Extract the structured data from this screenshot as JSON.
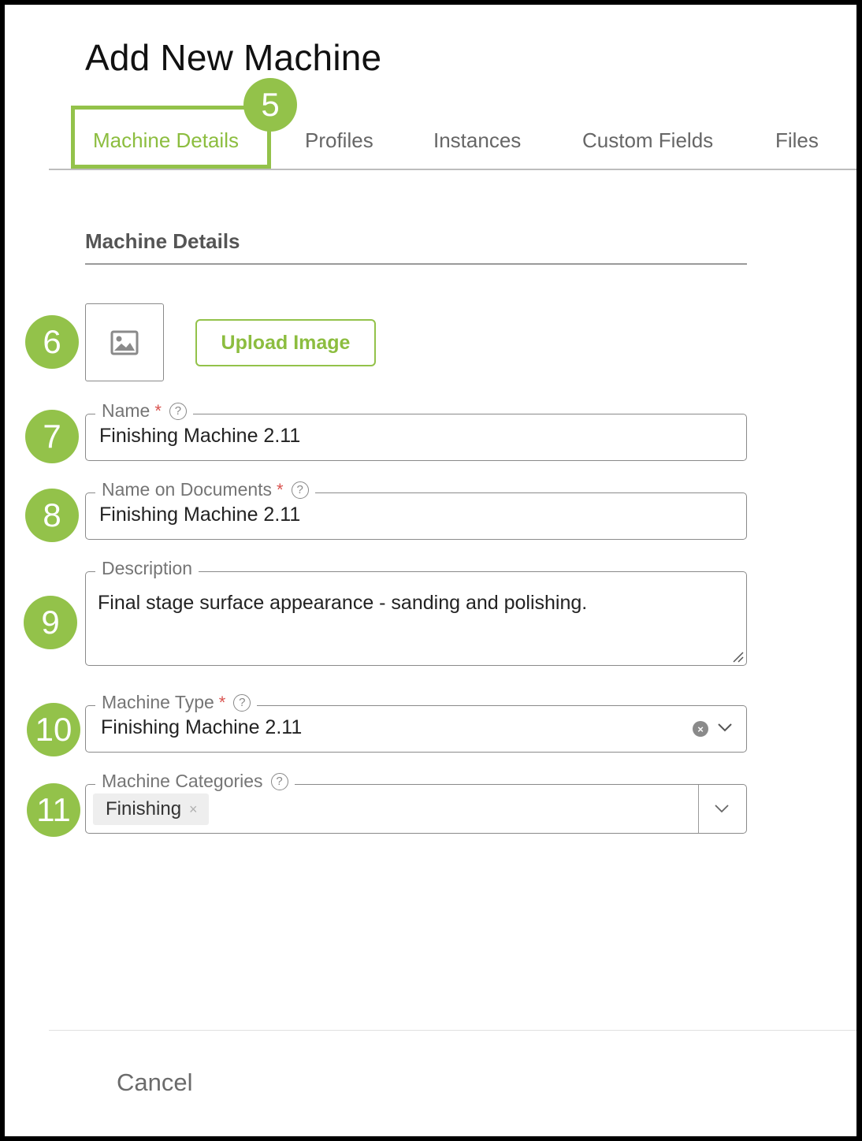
{
  "page": {
    "title": "Add New Machine"
  },
  "tabs": [
    {
      "label": "Machine Details",
      "active": true
    },
    {
      "label": "Profiles",
      "active": false
    },
    {
      "label": "Instances",
      "active": false
    },
    {
      "label": "Custom Fields",
      "active": false
    },
    {
      "label": "Files",
      "active": false
    }
  ],
  "markers": [
    "5",
    "6",
    "7",
    "8",
    "9",
    "10",
    "11"
  ],
  "section": {
    "title": "Machine Details"
  },
  "image": {
    "upload_label": "Upload Image",
    "placeholder_icon": "image-icon"
  },
  "fields": {
    "name": {
      "label": "Name",
      "required": "*",
      "help": "?",
      "value": "Finishing Machine 2.11"
    },
    "name_on_documents": {
      "label": "Name on Documents",
      "required": "*",
      "help": "?",
      "value": "Finishing Machine 2.11"
    },
    "description": {
      "label": "Description",
      "value": "Final stage surface appearance - sanding and polishing."
    },
    "machine_type": {
      "label": "Machine Type",
      "required": "*",
      "help": "?",
      "value": "Finishing Machine 2.11"
    },
    "machine_categories": {
      "label": "Machine Categories",
      "help": "?",
      "chips": [
        {
          "label": "Finishing",
          "remove": "×"
        }
      ]
    }
  },
  "footer": {
    "cancel_label": "Cancel"
  },
  "colors": {
    "accent": "#93c24a",
    "accent_text": "#8cbd3f",
    "required": "#d9534f"
  }
}
